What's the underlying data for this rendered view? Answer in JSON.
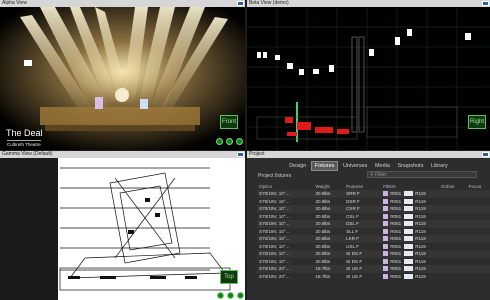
{
  "panels": {
    "alpha": {
      "title": "Alpha View",
      "show_name": "The Deal",
      "venue": "Culbreth Theatre",
      "view_button": "Front"
    },
    "beta": {
      "title": "Beta View (demo)",
      "view_button": "Right"
    },
    "gamma": {
      "title": "Gamma View (Default)",
      "view_button": "Top"
    },
    "project": {
      "title": "Project",
      "tabs": [
        "Design",
        "Fixtures",
        "Universes",
        "Media",
        "Snapshots",
        "Library"
      ],
      "active_tab": "Fixtures",
      "filter_placeholder": "Filter",
      "section_title": "Project fixtures",
      "columns": [
        "Optics",
        "Weight",
        "Purpose",
        "Filters",
        "Gobos",
        "Focus"
      ],
      "rows": [
        [
          "S70/19V, 10°...",
          "20.8lbs",
          "SRR F",
          "R051",
          "R119"
        ],
        [
          "S70/19V, 19°...",
          "20.8lbs",
          "DSR F",
          "R051",
          "R119"
        ],
        [
          "S70/19V, 10°...",
          "20.8lbs",
          "CSR F",
          "R051",
          "R119"
        ],
        [
          "S70/19V, 10°...",
          "20.8lbs",
          "CSL F",
          "R051",
          "R119"
        ],
        [
          "S70/19V, 10°...",
          "20.8lbs",
          "DSL F",
          "R051",
          "R119"
        ],
        [
          "S70/19V, 10°...",
          "20.8lbs",
          "SLL F",
          "R051",
          "R119"
        ],
        [
          "S70/19V, 19°...",
          "20.8lbs",
          "LKR F",
          "R051",
          "R119"
        ],
        [
          "S70/19V, 10°...",
          "20.8lbs",
          "USL F",
          "R051",
          "R119"
        ],
        [
          "S70/19V, 10°...",
          "20.8lbs",
          "SI DS F",
          "R051",
          "R119"
        ],
        [
          "S70/19V, 10°...",
          "20.8lbs",
          "SI DS F",
          "R051",
          "R119"
        ],
        [
          "S70/19V, 23°...",
          "18.7lbs",
          "SI US F",
          "R051",
          "R119"
        ],
        [
          "S70/19V, 23°...",
          "18.7lbs",
          "SI US F",
          "R051",
          "R119"
        ]
      ]
    }
  },
  "colors": {
    "titlebar": "#d6d6d6",
    "button_green": "#5fbf5f",
    "close_blue": "#2a5ea8"
  },
  "icons": [
    "camera-icon",
    "orbit-icon",
    "pan-icon",
    "zoom-icon",
    "search-icon",
    "close-icon"
  ]
}
